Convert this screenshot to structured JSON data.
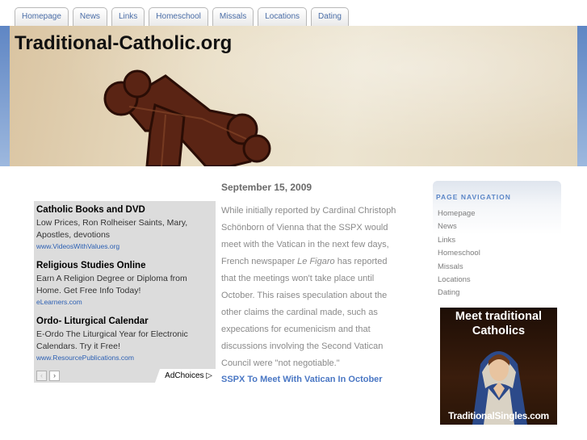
{
  "nav_tabs": [
    "Homepage",
    "News",
    "Links",
    "Homeschool",
    "Missals",
    "Locations",
    "Dating"
  ],
  "site_title": "Traditional-Catholic.org",
  "ads": [
    {
      "title": "Catholic Books and DVD",
      "body": "Low Prices, Ron Rolheiser Saints, Mary, Apostles, devotions",
      "url": "www.VideosWithValues.org"
    },
    {
      "title": "Religious Studies Online",
      "body": "Earn A Religion Degree or Diploma from Home. Get Free Info Today!",
      "url": "eLearners.com"
    },
    {
      "title": "Ordo- Liturgical Calendar",
      "body": "E-Ordo The Liturgical Year for Electronic Calendars. Try it Free!",
      "url": "www.ResourcePublications.com"
    }
  ],
  "ad_controls": {
    "prev": "‹",
    "next": "›",
    "adchoices": "AdChoices ▷"
  },
  "article": {
    "date": "September 15, 2009",
    "body_before": "While initially reported by Cardinal Christoph Schönborn of Vienna that the SSPX would meet with the Vatican in the next few days, French newspaper ",
    "body_italic": "Le Figaro",
    "body_after": " has reported that the meetings won't take place until October. This raises speculation about the other claims the cardinal made, such as expecations for ecumenicism and that discussions involving the Second Vatican Council were \"not negotiable.\"",
    "link": "SSPX To Meet With Vatican In October"
  },
  "page_navigation": {
    "title": "PAGE NAVIGATION",
    "items": [
      "Homepage",
      "News",
      "Links",
      "Homeschool",
      "Missals",
      "Locations",
      "Dating"
    ]
  },
  "singles_ad": {
    "top_text": "Meet traditional Catholics",
    "bottom_text": "TraditionalSingles.com"
  },
  "colors": {
    "link_blue": "#4a77c4",
    "tab_text": "#4a6da7",
    "header_edge": "#5f86c4"
  }
}
